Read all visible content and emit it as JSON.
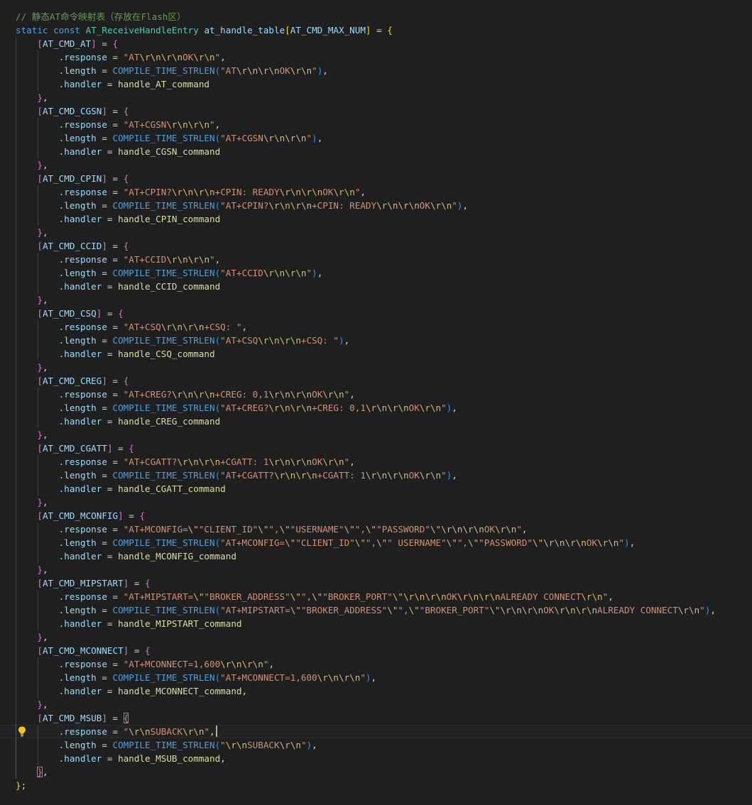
{
  "editor": {
    "code_comment": "// 静态AT命令映射表（存放在Flash区）",
    "declaration": {
      "static_keyword": "static",
      "const_keyword": "const",
      "type_name": "AT_ReceiveHandleEntry",
      "var_name": "at_handle_table",
      "size_macro": "AT_CMD_MAX_NUM"
    },
    "field_names": {
      "response": ".response",
      "length": ".length",
      "handler": ".handler"
    },
    "length_macro": "COMPILE_TIME_STRLEN",
    "entries": [
      {
        "key": "AT_CMD_AT",
        "response_tokens": [
          "\"AT",
          "\\r",
          "\\n",
          "\\r",
          "\\n",
          "OK",
          "\\r",
          "\\n",
          "\""
        ],
        "length_tokens": [
          "\"AT",
          "\\r",
          "\\n",
          "\\r",
          "\\n",
          "OK",
          "\\r",
          "\\n",
          "\""
        ],
        "handler": "handle_AT_command",
        "handler_suffix": ""
      },
      {
        "key": "AT_CMD_CGSN",
        "response_tokens": [
          "\"AT+CGSN",
          "\\r",
          "\\n",
          "\\r",
          "\\n",
          "\""
        ],
        "length_tokens": [
          "\"AT+CGSN",
          "\\r",
          "\\n",
          "\\r",
          "\\n",
          "\""
        ],
        "handler": "handle_CGSN_command",
        "handler_suffix": ""
      },
      {
        "key": "AT_CMD_CPIN",
        "response_tokens": [
          "\"AT+CPIN?",
          "\\r",
          "\\n",
          "\\r",
          "\\n",
          "+CPIN: READY",
          "\\r",
          "\\n",
          "\\r",
          "\\n",
          "OK",
          "\\r",
          "\\n",
          "\""
        ],
        "length_tokens": [
          "\"AT+CPIN?",
          "\\r",
          "\\n",
          "\\r",
          "\\n",
          "+CPIN: READY",
          "\\r",
          "\\n",
          "\\r",
          "\\n",
          "OK",
          "\\r",
          "\\n",
          "\""
        ],
        "handler": "handle_CPIN_command",
        "handler_suffix": ""
      },
      {
        "key": "AT_CMD_CCID",
        "response_tokens": [
          "\"AT+CCID",
          "\\r",
          "\\n",
          "\\r",
          "\\n",
          "\""
        ],
        "length_tokens": [
          "\"AT+CCID",
          "\\r",
          "\\n",
          "\\r",
          "\\n",
          "\""
        ],
        "handler": "handle_CCID_command",
        "handler_suffix": ""
      },
      {
        "key": "AT_CMD_CSQ",
        "response_tokens": [
          "\"AT+CSQ",
          "\\r",
          "\\n",
          "\\r",
          "\\n",
          "+CSQ: \""
        ],
        "length_tokens": [
          "\"AT+CSQ",
          "\\r",
          "\\n",
          "\\r",
          "\\n",
          "+CSQ: \""
        ],
        "handler": "handle_CSQ_command",
        "handler_suffix": ""
      },
      {
        "key": "AT_CMD_CREG",
        "response_tokens": [
          "\"AT+CREG?",
          "\\r",
          "\\n",
          "\\r",
          "\\n",
          "+CREG: 0,1",
          "\\r",
          "\\n",
          "\\r",
          "\\n",
          "OK",
          "\\r",
          "\\n",
          "\""
        ],
        "length_tokens": [
          "\"AT+CREG?",
          "\\r",
          "\\n",
          "\\r",
          "\\n",
          "+CREG: 0,1",
          "\\r",
          "\\n",
          "\\r",
          "\\n",
          "OK",
          "\\r",
          "\\n",
          "\""
        ],
        "handler": "handle_CREG_command",
        "handler_suffix": ""
      },
      {
        "key": "AT_CMD_CGATT",
        "response_tokens": [
          "\"AT+CGATT?",
          "\\r",
          "\\n",
          "\\r",
          "\\n",
          "+CGATT: 1",
          "\\r",
          "\\n",
          "\\r",
          "\\n",
          "OK",
          "\\r",
          "\\n",
          "\""
        ],
        "length_tokens": [
          "\"AT+CGATT?",
          "\\r",
          "\\n",
          "\\r",
          "\\n",
          "+CGATT: 1",
          "\\r",
          "\\n",
          "\\r",
          "\\n",
          "OK",
          "\\r",
          "\\n",
          "\""
        ],
        "handler": "handle_CGATT_command",
        "handler_suffix": ""
      },
      {
        "key": "AT_CMD_MCONFIG",
        "response_tokens": [
          "\"AT+MCONFIG=",
          "\\\"",
          "\"CLIENT_ID\"",
          "\\\"",
          "\",",
          "\\\"",
          "\"USERNAME\"",
          "\\\"",
          "\",",
          "\\\"",
          "\"PASSWORD\"",
          "\\\"",
          "\\r",
          "\\n",
          "\\r",
          "\\n",
          "OK",
          "\\r",
          "\\n",
          "\""
        ],
        "length_tokens": [
          "\"AT+MCONFIG=",
          "\\\"",
          "\"CLIENT_ID\"",
          "\\\"",
          "\",",
          "\\\"",
          "\" USERNAME\"",
          "\\\"",
          "\",",
          "\\\"",
          "\"PASSWORD\"",
          "\\\"",
          "\\r",
          "\\n",
          "\\r",
          "\\n",
          "OK",
          "\\r",
          "\\n",
          "\""
        ],
        "handler": "handle_MCONFIG_command",
        "handler_suffix": ""
      },
      {
        "key": "AT_CMD_MIPSTART",
        "response_tokens": [
          "\"AT+MIPSTART=",
          "\\\"",
          "\"BROKER_ADDRESS\"",
          "\\\"",
          "\",",
          "\\\"",
          "\"BROKER_PORT\"",
          "\\\"",
          "\\r",
          "\\n",
          "\\r",
          "\\n",
          "OK",
          "\\r",
          "\\n",
          "\\r",
          "\\n",
          "ALREADY CONNECT",
          "\\r",
          "\\n",
          "\""
        ],
        "length_tokens": [
          "\"AT+MIPSTART=",
          "\\\"",
          "\"BROKER_ADDRESS\"",
          "\\\"",
          "\",",
          "\\\"",
          "\"BROKER_PORT\"",
          "\\\"",
          "\\r",
          "\\n",
          "\\r",
          "\\n",
          "OK",
          "\\r",
          "\\n",
          "\\r",
          "\\n",
          "ALREADY CONNECT",
          "\\r",
          "\\n",
          "\""
        ],
        "handler": "handle_MIPSTART_command",
        "handler_suffix": ""
      },
      {
        "key": "AT_CMD_MCONNECT",
        "response_tokens": [
          "\"AT+MCONNECT=1,600",
          "\\r",
          "\\n",
          "\\r",
          "\\n",
          "\""
        ],
        "length_tokens": [
          "\"AT+MCONNECT=1,600",
          "\\r",
          "\\n",
          "\\r",
          "\\n",
          "\""
        ],
        "handler": "handle_MCONNECT_command",
        "handler_suffix": ","
      },
      {
        "key": "AT_CMD_MSUB",
        "response_tokens": [
          "\"",
          "\\r",
          "\\n",
          "SUBACK",
          "\\r",
          "\\n",
          "\""
        ],
        "length_tokens": [
          "\"",
          "\\r",
          "\\n",
          "SUBACK",
          "\\r",
          "\\n",
          "\""
        ],
        "handler": "handle_MSUB_command",
        "handler_suffix": ","
      }
    ],
    "closing": "};",
    "lightbulb_icon": "lightbulb-icon",
    "colors": {
      "background": "#1f1f1f",
      "comment": "#6a9955",
      "keyword": "#569cd6",
      "type": "#4ec9b0",
      "variable": "#9cdcfe",
      "string": "#ce9178",
      "escape": "#d7ba7d",
      "function": "#dcdcaa",
      "bracket_gold": "#ffd700",
      "bracket_orchid": "#da70d6",
      "bracket_blue": "#179fff",
      "lightbulb": "#f5c518"
    }
  }
}
